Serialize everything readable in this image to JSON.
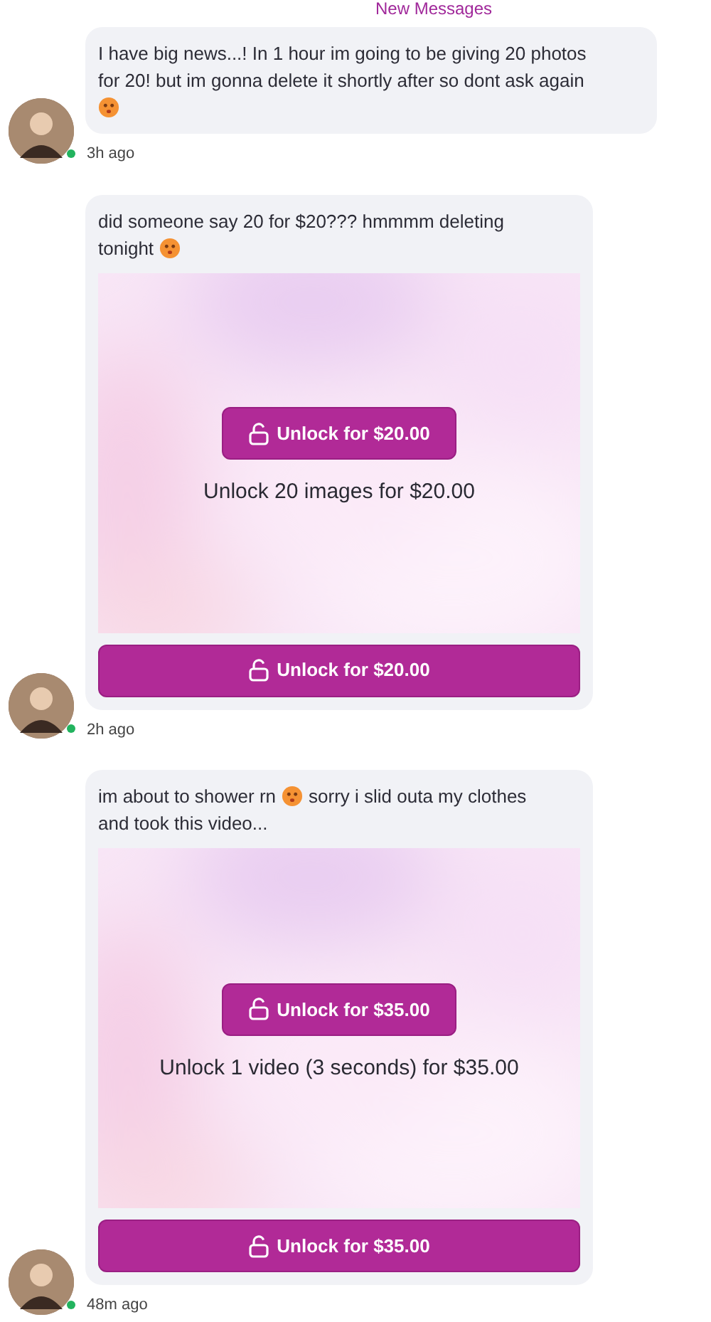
{
  "divider": {
    "label": "New Messages"
  },
  "messages": [
    {
      "lines": [
        [
          {
            "kind": "text",
            "text": "I have big news...! In 1 hour im going to be giving 20 photos"
          }
        ],
        [
          {
            "kind": "text",
            "text": "for 20! but im gonna delete it shortly after so dont ask again"
          }
        ],
        [
          {
            "kind": "emoji"
          }
        ]
      ],
      "online": true,
      "time": "3h ago"
    },
    {
      "lines": [
        [
          {
            "kind": "text",
            "text": "did someone say 20 for $20??? hmmmm deleting"
          }
        ],
        [
          {
            "kind": "text",
            "text": "tonight"
          },
          {
            "kind": "emoji"
          }
        ]
      ],
      "locked_media": {
        "kind": "picture",
        "unlock_button": "Unlock for $20.00",
        "caption": "Unlock 20 images for $20.00",
        "footer_button": "Unlock for $20.00"
      },
      "online": true,
      "time": "2h ago"
    },
    {
      "lines": [
        [
          {
            "kind": "text",
            "text": "im about to shower rn"
          },
          {
            "kind": "emoji"
          },
          {
            "kind": "text",
            "text": "sorry i slid outa my clothes"
          }
        ],
        [
          {
            "kind": "text",
            "text": "and took this video..."
          }
        ]
      ],
      "locked_media": {
        "kind": "picture",
        "unlock_button": "Unlock for $35.00",
        "caption": "Unlock 1 video (3 seconds) for $35.00",
        "footer_button": "Unlock for $35.00"
      },
      "online": true,
      "time": "48m ago"
    }
  ]
}
